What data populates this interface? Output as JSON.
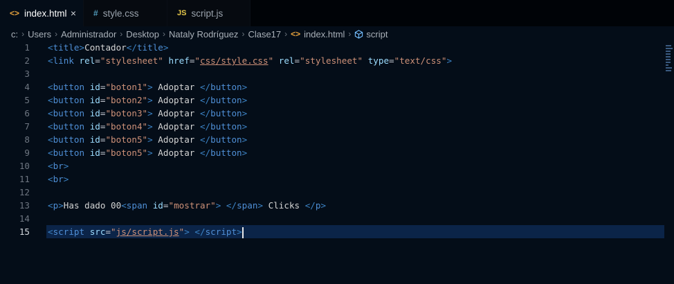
{
  "tabs": [
    {
      "label": "index.html",
      "icon": "<>",
      "icon_name": "html-file-icon",
      "active": true,
      "close": "×"
    },
    {
      "label": "style.css",
      "icon": "#",
      "icon_name": "css-file-icon",
      "active": false
    },
    {
      "label": "script.js",
      "icon": "JS",
      "icon_name": "js-file-icon",
      "active": false
    }
  ],
  "breadcrumb": {
    "items": [
      "c:",
      "Users",
      "Administrador",
      "Desktop",
      "Nataly Rodríguez",
      "Clase17",
      "index.html",
      "script"
    ],
    "separator": "›"
  },
  "editor": {
    "current_line": 15,
    "lines": [
      {
        "n": "1",
        "tokens": [
          [
            "tag",
            "<"
          ],
          [
            "tn",
            "title"
          ],
          [
            "tag",
            ">"
          ],
          [
            "tx",
            "Contador"
          ],
          [
            "tag",
            "</"
          ],
          [
            "tn",
            "title"
          ],
          [
            "tag",
            ">"
          ]
        ]
      },
      {
        "n": "2",
        "tokens": [
          [
            "tag",
            "<"
          ],
          [
            "tn",
            "link"
          ],
          [
            "tx",
            " "
          ],
          [
            "at",
            "rel"
          ],
          [
            "eq",
            "="
          ],
          [
            "st",
            "\"stylesheet\""
          ],
          [
            "tx",
            " "
          ],
          [
            "at",
            "href"
          ],
          [
            "eq",
            "="
          ],
          [
            "st",
            "\""
          ],
          [
            "stu",
            "css/style.css"
          ],
          [
            "st",
            "\""
          ],
          [
            "tx",
            " "
          ],
          [
            "at",
            "rel"
          ],
          [
            "eq",
            "="
          ],
          [
            "st",
            "\"stylesheet\""
          ],
          [
            "tx",
            " "
          ],
          [
            "at",
            "type"
          ],
          [
            "eq",
            "="
          ],
          [
            "st",
            "\"text/css\""
          ],
          [
            "tag",
            ">"
          ]
        ]
      },
      {
        "n": "3",
        "tokens": []
      },
      {
        "n": "4",
        "tokens": [
          [
            "tag",
            "<"
          ],
          [
            "tn",
            "button"
          ],
          [
            "tx",
            " "
          ],
          [
            "at",
            "id"
          ],
          [
            "eq",
            "="
          ],
          [
            "st",
            "\"boton1\""
          ],
          [
            "tag",
            ">"
          ],
          [
            "tx",
            " Adoptar "
          ],
          [
            "tag",
            "</"
          ],
          [
            "tn",
            "button"
          ],
          [
            "tag",
            ">"
          ]
        ]
      },
      {
        "n": "5",
        "tokens": [
          [
            "tag",
            "<"
          ],
          [
            "tn",
            "button"
          ],
          [
            "tx",
            " "
          ],
          [
            "at",
            "id"
          ],
          [
            "eq",
            "="
          ],
          [
            "st",
            "\"boton2\""
          ],
          [
            "tag",
            ">"
          ],
          [
            "tx",
            " Adoptar "
          ],
          [
            "tag",
            "</"
          ],
          [
            "tn",
            "button"
          ],
          [
            "tag",
            ">"
          ]
        ]
      },
      {
        "n": "6",
        "tokens": [
          [
            "tag",
            "<"
          ],
          [
            "tn",
            "button"
          ],
          [
            "tx",
            " "
          ],
          [
            "at",
            "id"
          ],
          [
            "eq",
            "="
          ],
          [
            "st",
            "\"boton3\""
          ],
          [
            "tag",
            ">"
          ],
          [
            "tx",
            " Adoptar "
          ],
          [
            "tag",
            "</"
          ],
          [
            "tn",
            "button"
          ],
          [
            "tag",
            ">"
          ]
        ]
      },
      {
        "n": "7",
        "tokens": [
          [
            "tag",
            "<"
          ],
          [
            "tn",
            "button"
          ],
          [
            "tx",
            " "
          ],
          [
            "at",
            "id"
          ],
          [
            "eq",
            "="
          ],
          [
            "st",
            "\"boton4\""
          ],
          [
            "tag",
            ">"
          ],
          [
            "tx",
            " Adoptar "
          ],
          [
            "tag",
            "</"
          ],
          [
            "tn",
            "button"
          ],
          [
            "tag",
            ">"
          ]
        ]
      },
      {
        "n": "8",
        "tokens": [
          [
            "tag",
            "<"
          ],
          [
            "tn",
            "button"
          ],
          [
            "tx",
            " "
          ],
          [
            "at",
            "id"
          ],
          [
            "eq",
            "="
          ],
          [
            "st",
            "\"boton5\""
          ],
          [
            "tag",
            ">"
          ],
          [
            "tx",
            " Adoptar "
          ],
          [
            "tag",
            "</"
          ],
          [
            "tn",
            "button"
          ],
          [
            "tag",
            ">"
          ]
        ]
      },
      {
        "n": "9",
        "tokens": [
          [
            "tag",
            "<"
          ],
          [
            "tn",
            "button"
          ],
          [
            "tx",
            " "
          ],
          [
            "at",
            "id"
          ],
          [
            "eq",
            "="
          ],
          [
            "st",
            "\"boton5\""
          ],
          [
            "tag",
            ">"
          ],
          [
            "tx",
            " Adoptar "
          ],
          [
            "tag",
            "</"
          ],
          [
            "tn",
            "button"
          ],
          [
            "tag",
            ">"
          ]
        ]
      },
      {
        "n": "10",
        "tokens": [
          [
            "tag",
            "<"
          ],
          [
            "tn",
            "br"
          ],
          [
            "tag",
            ">"
          ]
        ]
      },
      {
        "n": "11",
        "tokens": [
          [
            "tag",
            "<"
          ],
          [
            "tn",
            "br"
          ],
          [
            "tag",
            ">"
          ]
        ]
      },
      {
        "n": "12",
        "tokens": []
      },
      {
        "n": "13",
        "tokens": [
          [
            "tag",
            "<"
          ],
          [
            "tn",
            "p"
          ],
          [
            "tag",
            ">"
          ],
          [
            "tx",
            "Has dado 00"
          ],
          [
            "tag",
            "<"
          ],
          [
            "tn",
            "span"
          ],
          [
            "tx",
            " "
          ],
          [
            "at",
            "id"
          ],
          [
            "eq",
            "="
          ],
          [
            "st",
            "\"mostrar\""
          ],
          [
            "tag",
            ">"
          ],
          [
            "tx",
            " "
          ],
          [
            "tag",
            "</"
          ],
          [
            "tn",
            "span"
          ],
          [
            "tag",
            ">"
          ],
          [
            "tx",
            " Clicks "
          ],
          [
            "tag",
            "</"
          ],
          [
            "tn",
            "p"
          ],
          [
            "tag",
            ">"
          ]
        ]
      },
      {
        "n": "14",
        "tokens": []
      },
      {
        "n": "15",
        "tokens": [
          [
            "tag",
            "<"
          ],
          [
            "tn",
            "script"
          ],
          [
            "tx",
            " "
          ],
          [
            "at",
            "src"
          ],
          [
            "eq",
            "="
          ],
          [
            "st",
            "\""
          ],
          [
            "stu",
            "js/script.js"
          ],
          [
            "st",
            "\""
          ],
          [
            "tag",
            ">"
          ],
          [
            "tx",
            " "
          ],
          [
            "tag",
            "</"
          ],
          [
            "tn",
            "script"
          ],
          [
            "tag",
            ">"
          ]
        ]
      }
    ]
  },
  "colors": {
    "background": "#040d18",
    "tag": "#3b82c4",
    "attribute": "#9cdcfe",
    "string": "#ce9178",
    "current_line": "#0b2448"
  }
}
